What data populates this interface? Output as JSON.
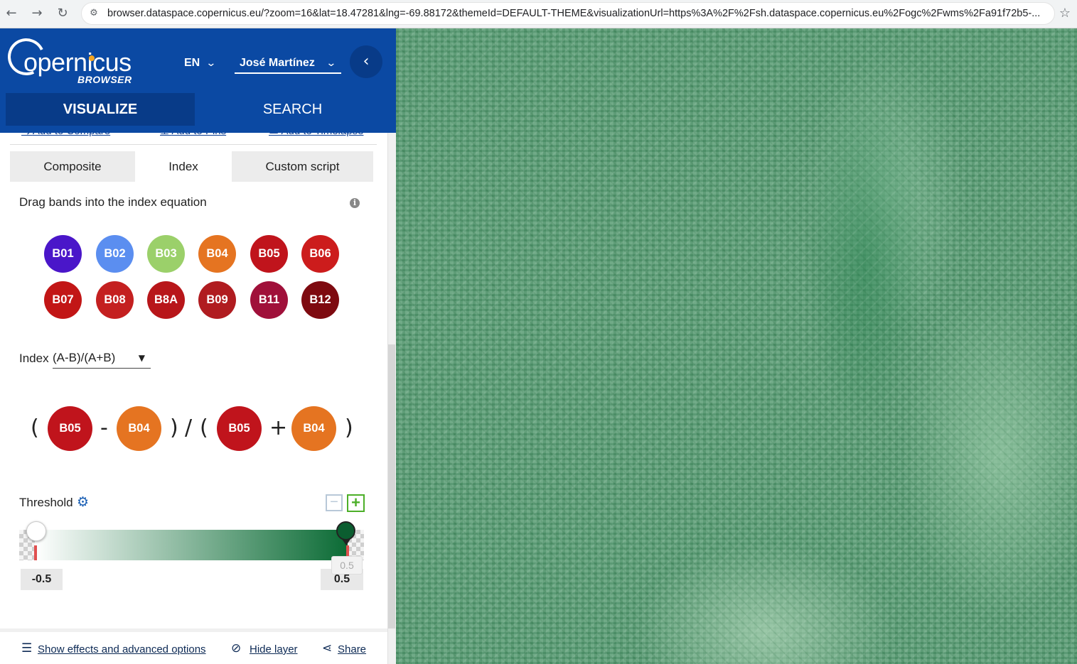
{
  "browser": {
    "url": "browser.dataspace.copernicus.eu/?zoom=16&lat=18.47281&lng=-69.88172&themeId=DEFAULT-THEME&visualizationUrl=https%3A%2F%2Fsh.dataspace.copernicus.eu%2Fogc%2Fwms%2Fa91f72b5-..."
  },
  "header": {
    "logo_word": "opernicus",
    "logo_sub": "BROWSER",
    "language": "EN",
    "user": "José Martínez",
    "tabs": {
      "visualize": "VISUALIZE",
      "search": "SEARCH"
    }
  },
  "actions": {
    "compare": "Add to Compare",
    "pins": "Add to Pins",
    "timelapse": "Add to Timelapse"
  },
  "modes": {
    "composite": "Composite",
    "index": "Index",
    "custom": "Custom script",
    "active": "Index"
  },
  "bands_hint": "Drag bands into the index equation",
  "bands": [
    {
      "id": "B01",
      "color": "#4a16c9"
    },
    {
      "id": "B02",
      "color": "#5b8ef0"
    },
    {
      "id": "B03",
      "color": "#9bd06a"
    },
    {
      "id": "B04",
      "color": "#e57421"
    },
    {
      "id": "B05",
      "color": "#c0141c"
    },
    {
      "id": "B06",
      "color": "#cc1c1c"
    },
    {
      "id": "B07",
      "color": "#c21616"
    },
    {
      "id": "B08",
      "color": "#c42020"
    },
    {
      "id": "B8A",
      "color": "#b8161a"
    },
    {
      "id": "B09",
      "color": "#b01c20"
    },
    {
      "id": "B11",
      "color": "#a0103a"
    },
    {
      "id": "B12",
      "color": "#7e0a10"
    }
  ],
  "index": {
    "label": "Index",
    "formula": "(A-B)/(A+B)",
    "equation": {
      "a1": "B05",
      "b1": "B04",
      "a2": "B05",
      "b2": "B04",
      "op1": "-",
      "op2": "+",
      "div": "/",
      "open": "(",
      "close": ")"
    }
  },
  "threshold": {
    "label": "Threshold",
    "min": "-0.5",
    "max": "0.5",
    "tooltip": "0.5",
    "gradient_start": "#ffffff",
    "gradient_end": "#0b6b35"
  },
  "footer": {
    "advanced": "Show effects and advanced options",
    "hide": "Hide layer",
    "share": "Share"
  },
  "colors": {
    "brand": "#0b49a3",
    "brand_dark": "#083b88",
    "accent_plus": "#4caf28"
  }
}
